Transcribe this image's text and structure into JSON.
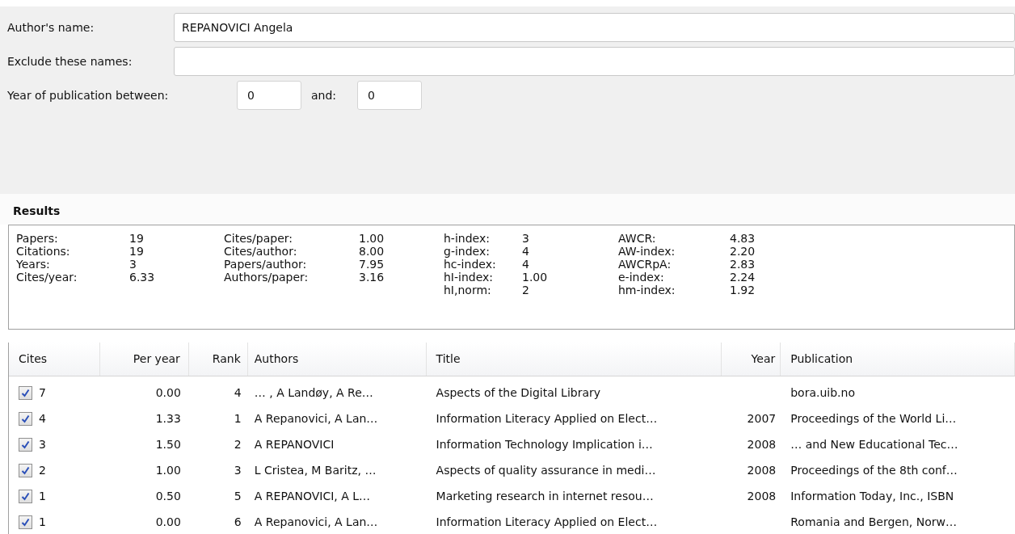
{
  "search_form": {
    "author_label": "Author's name:",
    "author_value": "REPANOVICI Angela",
    "exclude_label": "Exclude these names:",
    "year_label": "Year of publication between:",
    "year_from": "0",
    "and_label": "and:",
    "year_to": "0"
  },
  "results": {
    "title": "Results",
    "stat_groups": [
      [
        {
          "label": "Papers:",
          "value": "19"
        },
        {
          "label": "Citations:",
          "value": "19"
        },
        {
          "label": "Years:",
          "value": "3"
        },
        {
          "label": "Cites/year:",
          "value": "6.33"
        }
      ],
      [
        {
          "label": "Cites/paper:",
          "value": "1.00"
        },
        {
          "label": "Cites/author:",
          "value": "8.00"
        },
        {
          "label": "Papers/author:",
          "value": "7.95"
        },
        {
          "label": "Authors/paper:",
          "value": "3.16"
        }
      ],
      [
        {
          "label": "h-index:",
          "value": "3"
        },
        {
          "label": "g-index:",
          "value": "4"
        },
        {
          "label": "hc-index:",
          "value": "4"
        },
        {
          "label": "hI-index:",
          "value": "1.00"
        },
        {
          "label": "hI,norm:",
          "value": "2"
        }
      ],
      [
        {
          "label": "AWCR:",
          "value": "4.83"
        },
        {
          "label": "AW-index:",
          "value": "2.20"
        },
        {
          "label": "AWCRpA:",
          "value": "2.83"
        },
        {
          "label": "e-index:",
          "value": "2.24"
        },
        {
          "label": "hm-index:",
          "value": "1.92"
        }
      ]
    ]
  },
  "table": {
    "columns": [
      "Cites",
      "Per year",
      "Rank",
      "Authors",
      "Title",
      "Year",
      "Publication"
    ],
    "rows": [
      {
        "checked": true,
        "cites": "7",
        "per_year": "0.00",
        "rank": "4",
        "authors": "… , A Landøy, A Re…",
        "title": "Aspects of the Digital Library",
        "publication": "bora.uib.no"
      },
      {
        "checked": true,
        "cites": "4",
        "per_year": "1.33",
        "rank": "1",
        "authors": "A Repanovici, A Lan…",
        "title": "Information Literacy Applied on Elect…",
        "year": "2007",
        "publication": "Proceedings of the World Li…"
      },
      {
        "checked": true,
        "cites": "3",
        "per_year": "1.50",
        "rank": "2",
        "authors": "A REPANOVICI",
        "title": "Information Technology Implication i…",
        "year": "2008",
        "publication": "… and New Educational Tec…"
      },
      {
        "checked": true,
        "cites": "2",
        "per_year": "1.00",
        "rank": "3",
        "authors": "L Cristea, M Baritz, …",
        "title": "Aspects of quality assurance in medi…",
        "year": "2008",
        "publication": "Proceedings of the 8th conf…"
      },
      {
        "checked": true,
        "cites": "1",
        "per_year": "0.50",
        "rank": "5",
        "authors": "A REPANOVICI, A L…",
        "title": "Marketing research in internet resou…",
        "year": "2008",
        "publication": "Information Today, Inc., ISBN"
      },
      {
        "checked": true,
        "cites": "1",
        "per_year": "0.00",
        "rank": "6",
        "authors": "A Repanovici, A Lan…",
        "title": "Information Literacy Applied on Elect…",
        "publication": "Romania and Bergen, Norw…"
      }
    ]
  }
}
